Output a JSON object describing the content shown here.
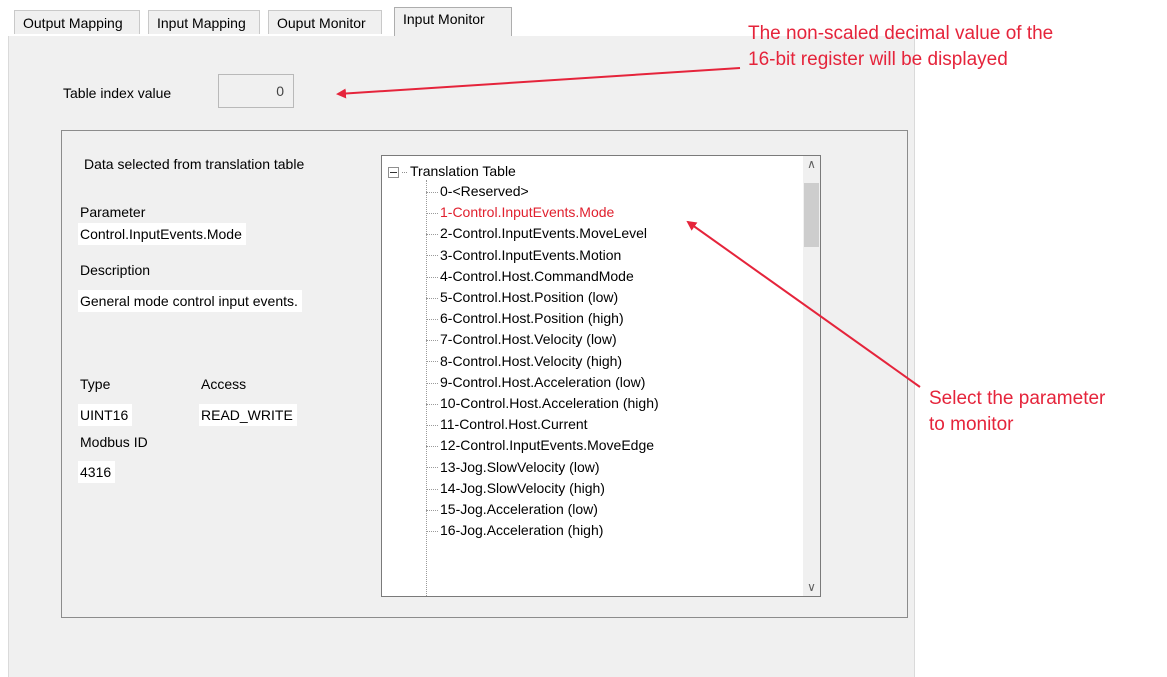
{
  "tabs": [
    {
      "label": "Output Mapping"
    },
    {
      "label": "Input Mapping"
    },
    {
      "label": "Ouput Monitor"
    },
    {
      "label": "Input Monitor",
      "active": true
    }
  ],
  "table_index": {
    "label": "Table index value",
    "value": "0"
  },
  "details": {
    "header": "Data selected from translation table",
    "parameter_label": "Parameter",
    "parameter_value": "Control.InputEvents.Mode",
    "description_label": "Description",
    "description_value": "General mode control input events.",
    "type_label": "Type",
    "type_value": "UINT16",
    "access_label": "Access",
    "access_value": "READ_WRITE",
    "modbus_label": "Modbus ID",
    "modbus_value": "4316"
  },
  "tree": {
    "root": "Translation Table",
    "selected_index": 1,
    "items": [
      "0-<Reserved>",
      "1-Control.InputEvents.Mode",
      "2-Control.InputEvents.MoveLevel",
      "3-Control.InputEvents.Motion",
      "4-Control.Host.CommandMode",
      "5-Control.Host.Position (low)",
      "6-Control.Host.Position (high)",
      "7-Control.Host.Velocity (low)",
      "8-Control.Host.Velocity (high)",
      "9-Control.Host.Acceleration (low)",
      "10-Control.Host.Acceleration (high)",
      "11-Control.Host.Current",
      "12-Control.InputEvents.MoveEdge",
      "13-Jog.SlowVelocity (low)",
      "14-Jog.SlowVelocity (high)",
      "15-Jog.Acceleration (low)",
      "16-Jog.Acceleration (high)"
    ]
  },
  "annotations": {
    "top_line1": "The non-scaled decimal value of the",
    "top_line2": "16-bit register will be displayed",
    "right_line1": "Select the parameter",
    "right_line2": "to monitor"
  },
  "colors": {
    "annotation": "#e5243b",
    "selected_item": "#e0202e"
  }
}
